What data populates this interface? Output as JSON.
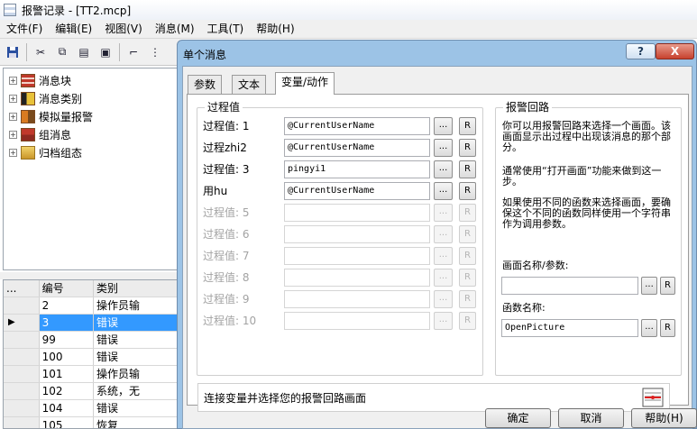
{
  "window": {
    "title": "报警记录 - [TT2.mcp]",
    "menu": [
      "文件(F)",
      "编辑(E)",
      "视图(V)",
      "消息(M)",
      "工具(T)",
      "帮助(H)"
    ]
  },
  "tree": {
    "items": [
      {
        "label": "消息块",
        "icon": "message-block-icon"
      },
      {
        "label": "消息类别",
        "icon": "message-class-icon"
      },
      {
        "label": "模拟量报警",
        "icon": "analog-alarm-icon"
      },
      {
        "label": "组消息",
        "icon": "group-message-icon"
      },
      {
        "label": "归档组态",
        "icon": "archive-config-icon"
      }
    ]
  },
  "grid": {
    "headers": [
      "...",
      "编号",
      "类别"
    ],
    "rows": [
      {
        "num": "2",
        "cat": "操作员输"
      },
      {
        "num": "3",
        "cat": "错误",
        "selected": true
      },
      {
        "num": "99",
        "cat": "错误"
      },
      {
        "num": "100",
        "cat": "错误"
      },
      {
        "num": "101",
        "cat": "操作员输"
      },
      {
        "num": "102",
        "cat": "系统，无"
      },
      {
        "num": "104",
        "cat": "错误"
      },
      {
        "num": "105",
        "cat": "恢复"
      }
    ]
  },
  "dialog": {
    "title": "单个消息",
    "help_button": "?",
    "close_button": "X",
    "tabs": [
      "参数",
      "文本",
      "变量/动作"
    ],
    "active_tab": "变量/动作",
    "process_group": {
      "title": "过程值",
      "rows": [
        {
          "label": "过程值: 1",
          "value": "@CurrentUserName",
          "enabled": true
        },
        {
          "label": "过程zhi2",
          "value": "@CurrentUserName",
          "enabled": true
        },
        {
          "label": "过程值: 3",
          "value": "pingyi1",
          "enabled": true
        },
        {
          "label": "用hu",
          "value": "@CurrentUserName",
          "enabled": true
        },
        {
          "label": "过程值: 5",
          "value": "",
          "enabled": false
        },
        {
          "label": "过程值: 6",
          "value": "",
          "enabled": false
        },
        {
          "label": "过程值: 7",
          "value": "",
          "enabled": false
        },
        {
          "label": "过程值: 8",
          "value": "",
          "enabled": false
        },
        {
          "label": "过程值: 9",
          "value": "",
          "enabled": false
        },
        {
          "label": "过程值: 10",
          "value": "",
          "enabled": false
        }
      ],
      "dots_label": "...",
      "r_label": "R"
    },
    "loop_group": {
      "title": "报警回路",
      "desc1": "你可以用报警回路来选择一个画面。该画面显示出过程中出现该消息的那个部分。",
      "desc2": "通常使用“打开画面”功能来做到这一步。",
      "desc3": "如果使用不同的函数来选择画面，要确保这个不同的函数同样使用一个字符串作为调用参数。",
      "screen_label": "画面名称/参数:",
      "screen_value": "",
      "function_label": "函数名称:",
      "function_value": "OpenPicture"
    },
    "status_text": "连接变量并选择您的报警回路画面",
    "buttons": {
      "ok": "确定",
      "cancel": "取消",
      "help": "帮助(H)"
    }
  }
}
